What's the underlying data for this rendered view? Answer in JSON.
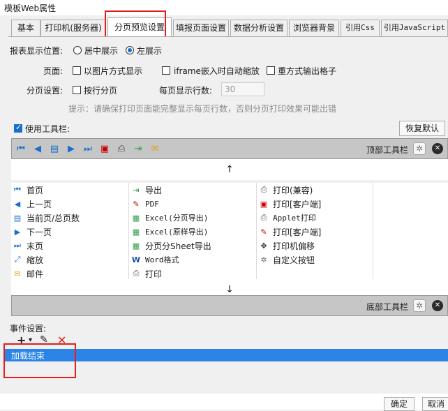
{
  "window": {
    "title": "模板Web属性"
  },
  "tabs": [
    {
      "label": "基本"
    },
    {
      "label": "打印机(服务器)"
    },
    {
      "label": "分页预览设置"
    },
    {
      "label": "填报页面设置"
    },
    {
      "label": "数据分析设置"
    },
    {
      "label": "浏览器背景"
    },
    {
      "label": "引用Css"
    },
    {
      "label": "引用JavaScript"
    }
  ],
  "report_position": {
    "label": "报表显示位置:",
    "center": "居中展示",
    "left": "左展示",
    "selected": "左展示"
  },
  "page": {
    "label": "页面:",
    "opt_image": "以图片方式显示",
    "opt_iframe": "iframe嵌入时自动缩放",
    "opt_grid": "重方式输出格子"
  },
  "paging": {
    "label": "分页设置:",
    "opt_row": "按行分页",
    "rows_label": "每页显示行数:",
    "rows_value": "30"
  },
  "hint": "提示：请确保打印页面能完整显示每页行数，否则分页打印效果可能出错",
  "toolbar_section": {
    "use_toolbar": "使用工具栏:",
    "restore_default": "恢复默认",
    "top_toolbar": "顶部工具栏",
    "bottom_toolbar": "底部工具栏"
  },
  "toolbar_icons": [
    "first-page-icon",
    "prev-page-icon",
    "page-count-icon",
    "next-page-icon",
    "last-page-icon",
    "pdf-print-icon",
    "print-icon",
    "export-icon",
    "email-icon"
  ],
  "buttons_col1": [
    "首页",
    "上一页",
    "当前页/总页数",
    "下一页",
    "末页",
    "缩放",
    "邮件"
  ],
  "buttons_col2": [
    "导出",
    "PDF",
    "Excel(分页导出)",
    "Excel(原样导出)",
    "分页分Sheet导出",
    "Word格式",
    "打印"
  ],
  "buttons_col3": [
    "打印(兼容)",
    "打印[客户端]",
    "Applet打印",
    "打印[客户端]",
    "打印机偏移",
    "自定义按钮"
  ],
  "events": {
    "label": "事件设置:",
    "items": [
      "加载结束"
    ]
  },
  "footer": {
    "ok": "确定",
    "cancel": "取消"
  },
  "colors": {
    "selection": "#2b84e6",
    "highlight_box": "#e01f1f"
  }
}
